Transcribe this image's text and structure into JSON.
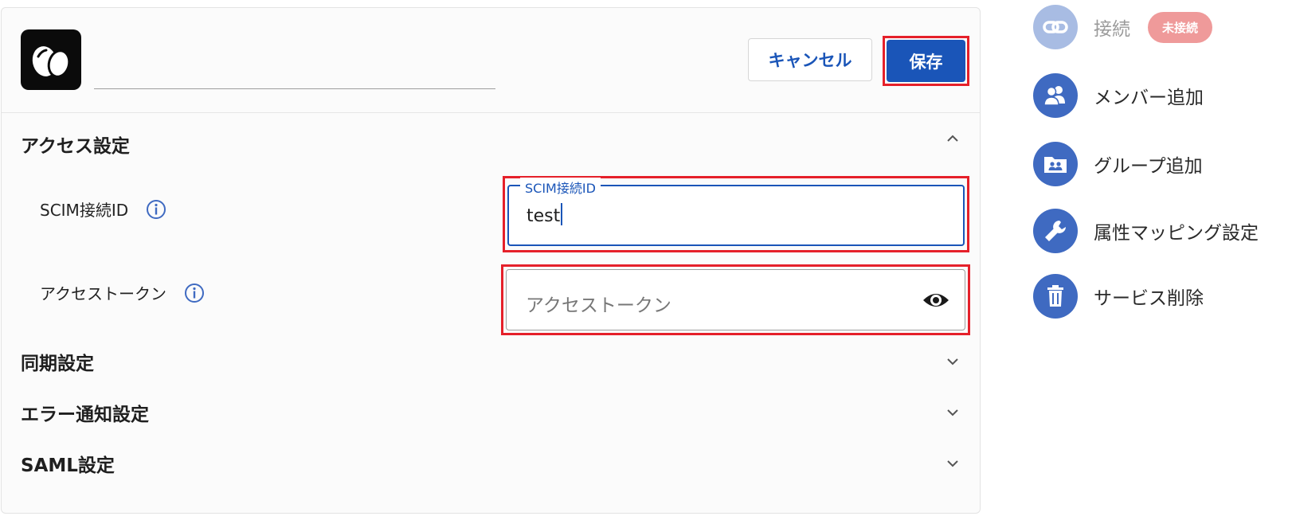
{
  "header": {
    "name_value": "",
    "cancel_label": "キャンセル",
    "save_label": "保存"
  },
  "access": {
    "title": "アクセス設定",
    "scim_label": "SCIM接続ID",
    "scim_float_label": "SCIM接続ID",
    "scim_value": "test",
    "token_label": "アクセストークン",
    "token_placeholder": "アクセストークン"
  },
  "sections": {
    "sync": "同期設定",
    "error": "エラー通知設定",
    "saml": "SAML設定"
  },
  "side_menu": {
    "connect": "接続",
    "connect_badge": "未接続",
    "add_member": "メンバー追加",
    "add_group": "グループ追加",
    "attribute_mapping": "属性マッピング設定",
    "delete_service": "サービス削除"
  },
  "colors": {
    "primary": "#1a55b8",
    "highlight": "#e5202a",
    "badge": "#ef9a9a",
    "side_icon": "#3f6ac1"
  }
}
